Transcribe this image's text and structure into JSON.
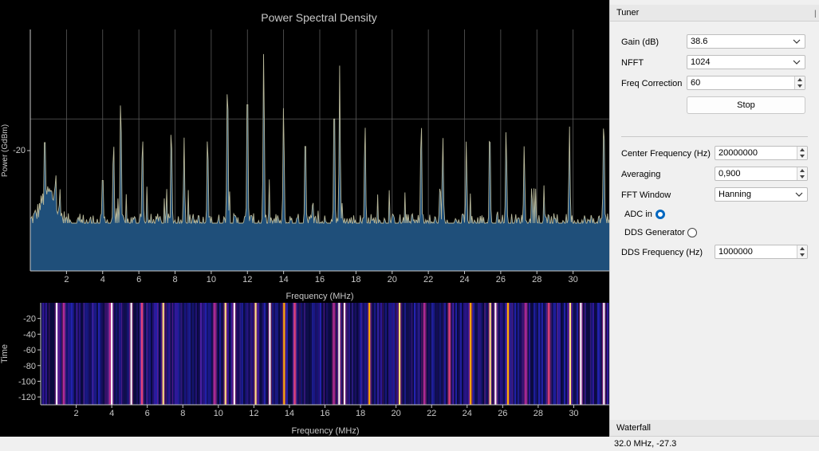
{
  "psd": {
    "title": "Power Spectral Density",
    "xlabel": "Frequency (MHz)",
    "ylabel": "Power (GdBm)",
    "ytick": "-20"
  },
  "waterfall_plot": {
    "xlabel": "Frequency (MHz)",
    "ylabel": "Time",
    "yticks": [
      "-20",
      "-40",
      "-60",
      "-80",
      "-100",
      "-120"
    ]
  },
  "chart_data": [
    {
      "type": "area",
      "title": "Power Spectral Density",
      "xlabel": "Frequency (MHz)",
      "ylabel": "Power (GdBm)",
      "xlim": [
        0,
        32
      ],
      "ylim": [
        -32.4,
        -12.7
      ],
      "x_ticks": [
        2,
        4,
        6,
        8,
        10,
        12,
        14,
        16,
        18,
        20,
        22,
        24,
        26,
        28,
        30
      ],
      "y_ticks": [
        -20
      ],
      "grid": true,
      "baseline_dbm": -28.5,
      "peaks": [
        {
          "x": 0.8,
          "y": -20.0
        },
        {
          "x": 1.4,
          "y": -24.0
        },
        {
          "x": 4.0,
          "y": -24.0
        },
        {
          "x": 4.6,
          "y": -21.3
        },
        {
          "x": 5.0,
          "y": -17.4
        },
        {
          "x": 6.2,
          "y": -20.8
        },
        {
          "x": 7.8,
          "y": -21.5
        },
        {
          "x": 8.5,
          "y": -21.5
        },
        {
          "x": 9.8,
          "y": -20.8
        },
        {
          "x": 10.9,
          "y": -15.7
        },
        {
          "x": 12.0,
          "y": -16.0
        },
        {
          "x": 12.9,
          "y": -14.2
        },
        {
          "x": 14.0,
          "y": -18.5
        },
        {
          "x": 15.2,
          "y": -20.4
        },
        {
          "x": 16.8,
          "y": -17.5
        },
        {
          "x": 17.1,
          "y": -15.6
        },
        {
          "x": 18.5,
          "y": -19.9
        },
        {
          "x": 21.6,
          "y": -20.8
        },
        {
          "x": 22.8,
          "y": -21.1
        },
        {
          "x": 24.1,
          "y": -21.6
        },
        {
          "x": 25.4,
          "y": -20.9
        },
        {
          "x": 26.3,
          "y": -20.3
        },
        {
          "x": 27.3,
          "y": -22.0
        },
        {
          "x": 29.8,
          "y": -20.5
        },
        {
          "x": 31.7,
          "y": -19.1
        }
      ]
    },
    {
      "type": "heatmap",
      "title": "Waterfall",
      "xlabel": "Frequency (MHz)",
      "ylabel": "Time",
      "xlim": [
        0,
        32
      ],
      "ylim": [
        -130,
        0
      ],
      "x_ticks": [
        2,
        4,
        6,
        8,
        10,
        12,
        14,
        16,
        18,
        20,
        22,
        24,
        26,
        28,
        30
      ],
      "y_ticks": [
        -20,
        -40,
        -60,
        -80,
        -100,
        -120
      ],
      "lines": [
        {
          "x": 0.9,
          "level": 1.0
        },
        {
          "x": 1.3,
          "level": 0.6
        },
        {
          "x": 3.9,
          "level": 0.6
        },
        {
          "x": 4.0,
          "level": 1.0
        },
        {
          "x": 5.1,
          "level": 1.0
        },
        {
          "x": 5.7,
          "level": 0.7
        },
        {
          "x": 6.9,
          "level": 0.9
        },
        {
          "x": 9.8,
          "level": 0.6
        },
        {
          "x": 10.4,
          "level": 0.9
        },
        {
          "x": 10.9,
          "level": 1.0
        },
        {
          "x": 12.1,
          "level": 0.9
        },
        {
          "x": 12.9,
          "level": 1.0
        },
        {
          "x": 13.7,
          "level": 0.8
        },
        {
          "x": 14.3,
          "level": 0.7
        },
        {
          "x": 16.5,
          "level": 0.6
        },
        {
          "x": 16.8,
          "level": 1.0
        },
        {
          "x": 17.1,
          "level": 1.0
        },
        {
          "x": 18.5,
          "level": 0.8
        },
        {
          "x": 20.2,
          "level": 0.9
        },
        {
          "x": 21.6,
          "level": 0.6
        },
        {
          "x": 23.0,
          "level": 0.7
        },
        {
          "x": 24.2,
          "level": 0.8
        },
        {
          "x": 25.3,
          "level": 0.9
        },
        {
          "x": 25.6,
          "level": 1.0
        },
        {
          "x": 26.3,
          "level": 0.8
        },
        {
          "x": 27.3,
          "level": 0.6
        },
        {
          "x": 28.6,
          "level": 0.7
        },
        {
          "x": 29.8,
          "level": 0.9
        },
        {
          "x": 30.4,
          "level": 1.0
        },
        {
          "x": 31.7,
          "level": 1.0
        }
      ]
    }
  ],
  "tuner": {
    "title": "Tuner",
    "gain_label": "Gain (dB)",
    "gain_value": "38.6",
    "nfft_label": "NFFT",
    "nfft_value": "1024",
    "freq_corr_label": "Freq Correction",
    "freq_corr_value": "60",
    "stop_label": "Stop",
    "center_freq_label": "Center Frequency (Hz)",
    "center_freq_value": "20000000",
    "averaging_label": "Averaging",
    "averaging_value": "0,900",
    "fft_window_label": "FFT Window",
    "fft_window_value": "Hanning",
    "adc_label": "ADC in",
    "dds_gen_label": "DDS Generator",
    "dds_freq_label": "DDS Frequency (Hz)",
    "dds_freq_value": "1000000"
  },
  "waterfall_dock": {
    "title": "Waterfall"
  },
  "status": {
    "text": "32.0 MHz, -27.3"
  },
  "colors": {
    "psd_fill": "#1f4f7a",
    "psd_line": "#b8b89a",
    "grid": "#5a5a5a",
    "axis_text": "#c8c8c8",
    "radio_selected": "#0067c0"
  }
}
